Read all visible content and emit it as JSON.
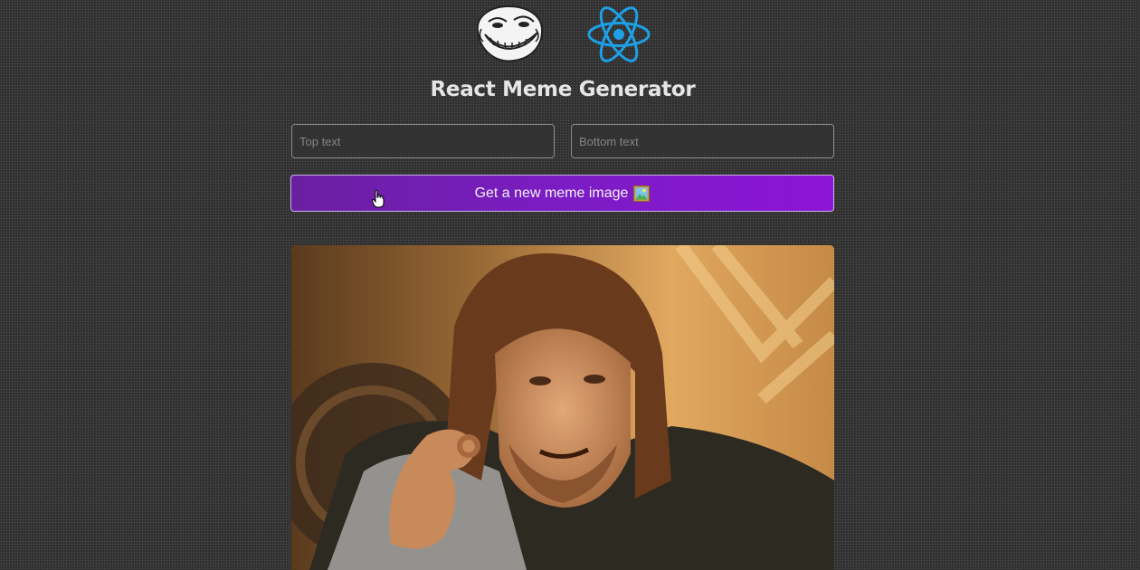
{
  "header": {
    "title": "React Meme Generator",
    "logos": [
      "troll-face-icon",
      "react-atom-icon"
    ]
  },
  "form": {
    "top_text": {
      "value": "",
      "placeholder": "Top text"
    },
    "bottom_text": {
      "value": "",
      "placeholder": "Bottom text"
    },
    "button": {
      "label": "Get a new meme image",
      "icon": "framed-picture-icon"
    }
  },
  "meme": {
    "image": "one-does-not-simply-meme"
  },
  "colors": {
    "background": "#202020",
    "button_gradient_start": "#6a1fa0",
    "button_gradient_end": "#8c14d6",
    "react_blue": "#1ea0e6"
  }
}
